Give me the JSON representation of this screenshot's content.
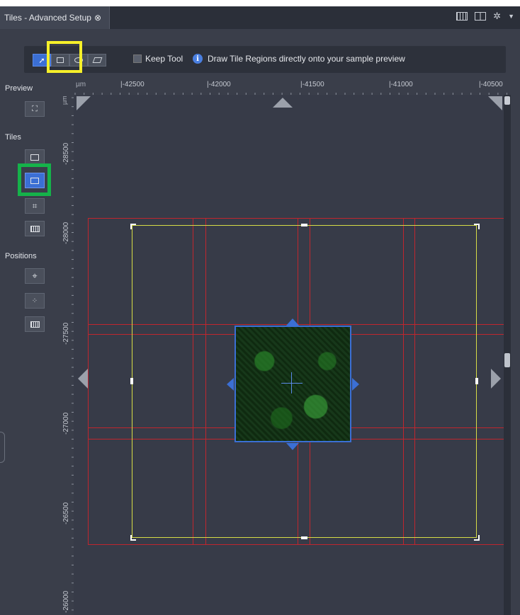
{
  "tab": {
    "title": "Tiles - Advanced Setup",
    "close_glyph": "⊗"
  },
  "tab_icons": [
    "grid-view-icon",
    "split-view-icon",
    "gear-icon",
    "dropdown-caret-icon"
  ],
  "toolbar": {
    "tools": [
      {
        "name": "pointer-tool",
        "active": true,
        "icon": "cursor-icon"
      },
      {
        "name": "rectangle-tool",
        "active": false,
        "icon": "rectangle-icon"
      },
      {
        "name": "ellipse-tool",
        "active": false,
        "icon": "ellipse-icon"
      },
      {
        "name": "parallelogram-tool",
        "active": false,
        "icon": "parallelogram-icon"
      }
    ],
    "keep_tool_label": "Keep Tool",
    "keep_tool_checked": false,
    "info_glyph": "i",
    "info_text": "Draw Tile Regions directly onto your sample preview"
  },
  "sidebar": {
    "preview_label": "Preview",
    "tiles_label": "Tiles",
    "positions_label": "Positions"
  },
  "ruler": {
    "unit": "µm",
    "x_ticks": [
      "|-42500",
      "|-42000",
      "|-41500",
      "|-41000",
      "|-40500"
    ],
    "y_ticks": [
      "-28500",
      "-28000",
      "-27500",
      "-27000",
      "-26500",
      "-26000"
    ]
  },
  "colors": {
    "highlight_yellow": "#f6f02a",
    "highlight_green": "#15b24a",
    "tile_grid_red": "#c0262e",
    "tile_region_yellow": "#d7dd46",
    "accent_blue": "#3b6fd4"
  }
}
